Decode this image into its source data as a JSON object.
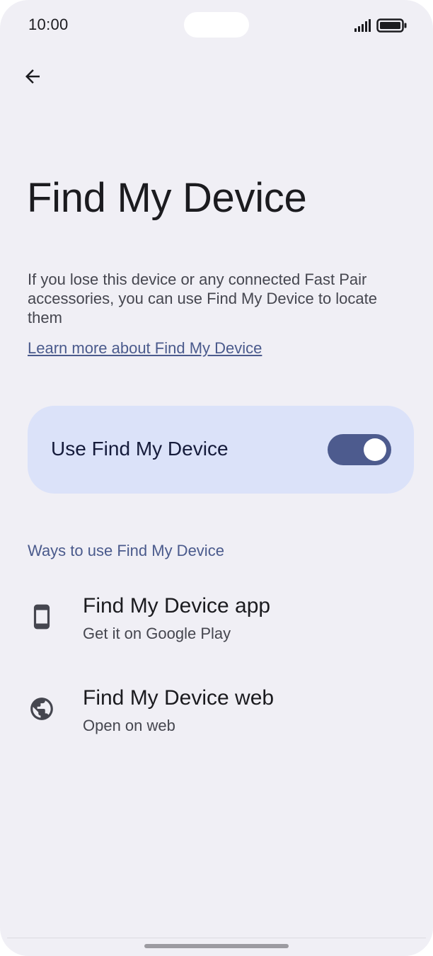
{
  "status_bar": {
    "time": "10:00",
    "signal_icon": "signal-bars-icon",
    "battery_icon": "battery-full-icon"
  },
  "header": {
    "back_icon": "arrow-back-icon",
    "title": "Find My Device"
  },
  "description": "If you lose this device or any connected Fast Pair accessories, you can use Find My Device to locate them",
  "learn_more_link": "Learn more about Find My Device",
  "main_toggle": {
    "label": "Use Find My Device",
    "enabled": true
  },
  "section": {
    "header": "Ways to use Find My Device",
    "items": [
      {
        "icon": "smartphone-icon",
        "title": "Find My Device app",
        "subtitle": "Get it on Google Play"
      },
      {
        "icon": "globe-icon",
        "title": "Find My Device web",
        "subtitle": "Open on web"
      }
    ]
  },
  "colors": {
    "background": "#f0eff5",
    "card": "#dbe2f9",
    "accent": "#4d5b8e",
    "link": "#4a5a8c",
    "text_primary": "#1b1b1f",
    "text_secondary": "#45464f"
  }
}
